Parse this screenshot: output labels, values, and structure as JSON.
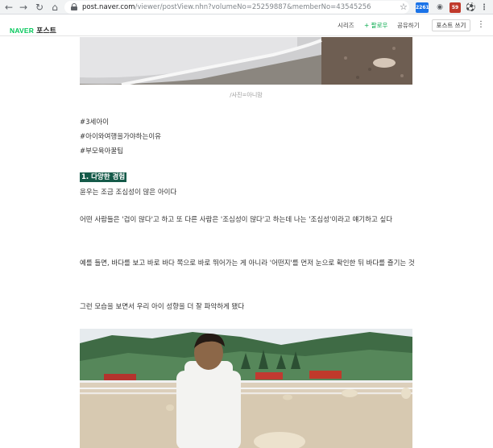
{
  "browser": {
    "back_icon": "arrow-left-icon",
    "forward_icon": "arrow-right-icon",
    "reload_icon": "reload-icon",
    "home_icon": "home-icon",
    "url_host": "post.naver.com",
    "url_path": "/viewer/postView.nhn?volumeNo=25259887&memberNo=43545256",
    "bookmark_icon": "star-icon",
    "extension_badge": "2261",
    "extension_red_badge": "59"
  },
  "header": {
    "logo_brand": "NAVER",
    "logo_service": "포스트",
    "series_link": "시리즈",
    "follow_link": "+ 팔로우",
    "share_link": "공유하기",
    "write_button": "포스트 쓰기",
    "more_icon": "more-vertical-icon"
  },
  "article": {
    "photo_caption": "/사진=아니맘",
    "tags": [
      "#3세아이",
      "#아이와여행을가야하는이유",
      "#부모육아꿀팁"
    ],
    "heading": "1. 다양한 경험",
    "paragraphs": [
      "윤우는 조금 조심성이 많은 아이다",
      "어떤 사람들은 '겁이 많다'고 하고 또 다른 사람은 '조심성이 많다'고 하는데 나는 '조심성'이라고 얘기하고 싶다",
      "예를 들면, 바다를 보고 바로 바다 쪽으로 바로 뛰어가는 게 아니라 '어떤지'를 먼저 눈으로 확인한 뒤 바다를 즐기는 것",
      "그런 모습을 보면서 우리 아이 성향을 더 잘 파악하게 됐다"
    ]
  },
  "colors": {
    "naver_green": "#03c75a",
    "heading_bg": "#155a49"
  }
}
